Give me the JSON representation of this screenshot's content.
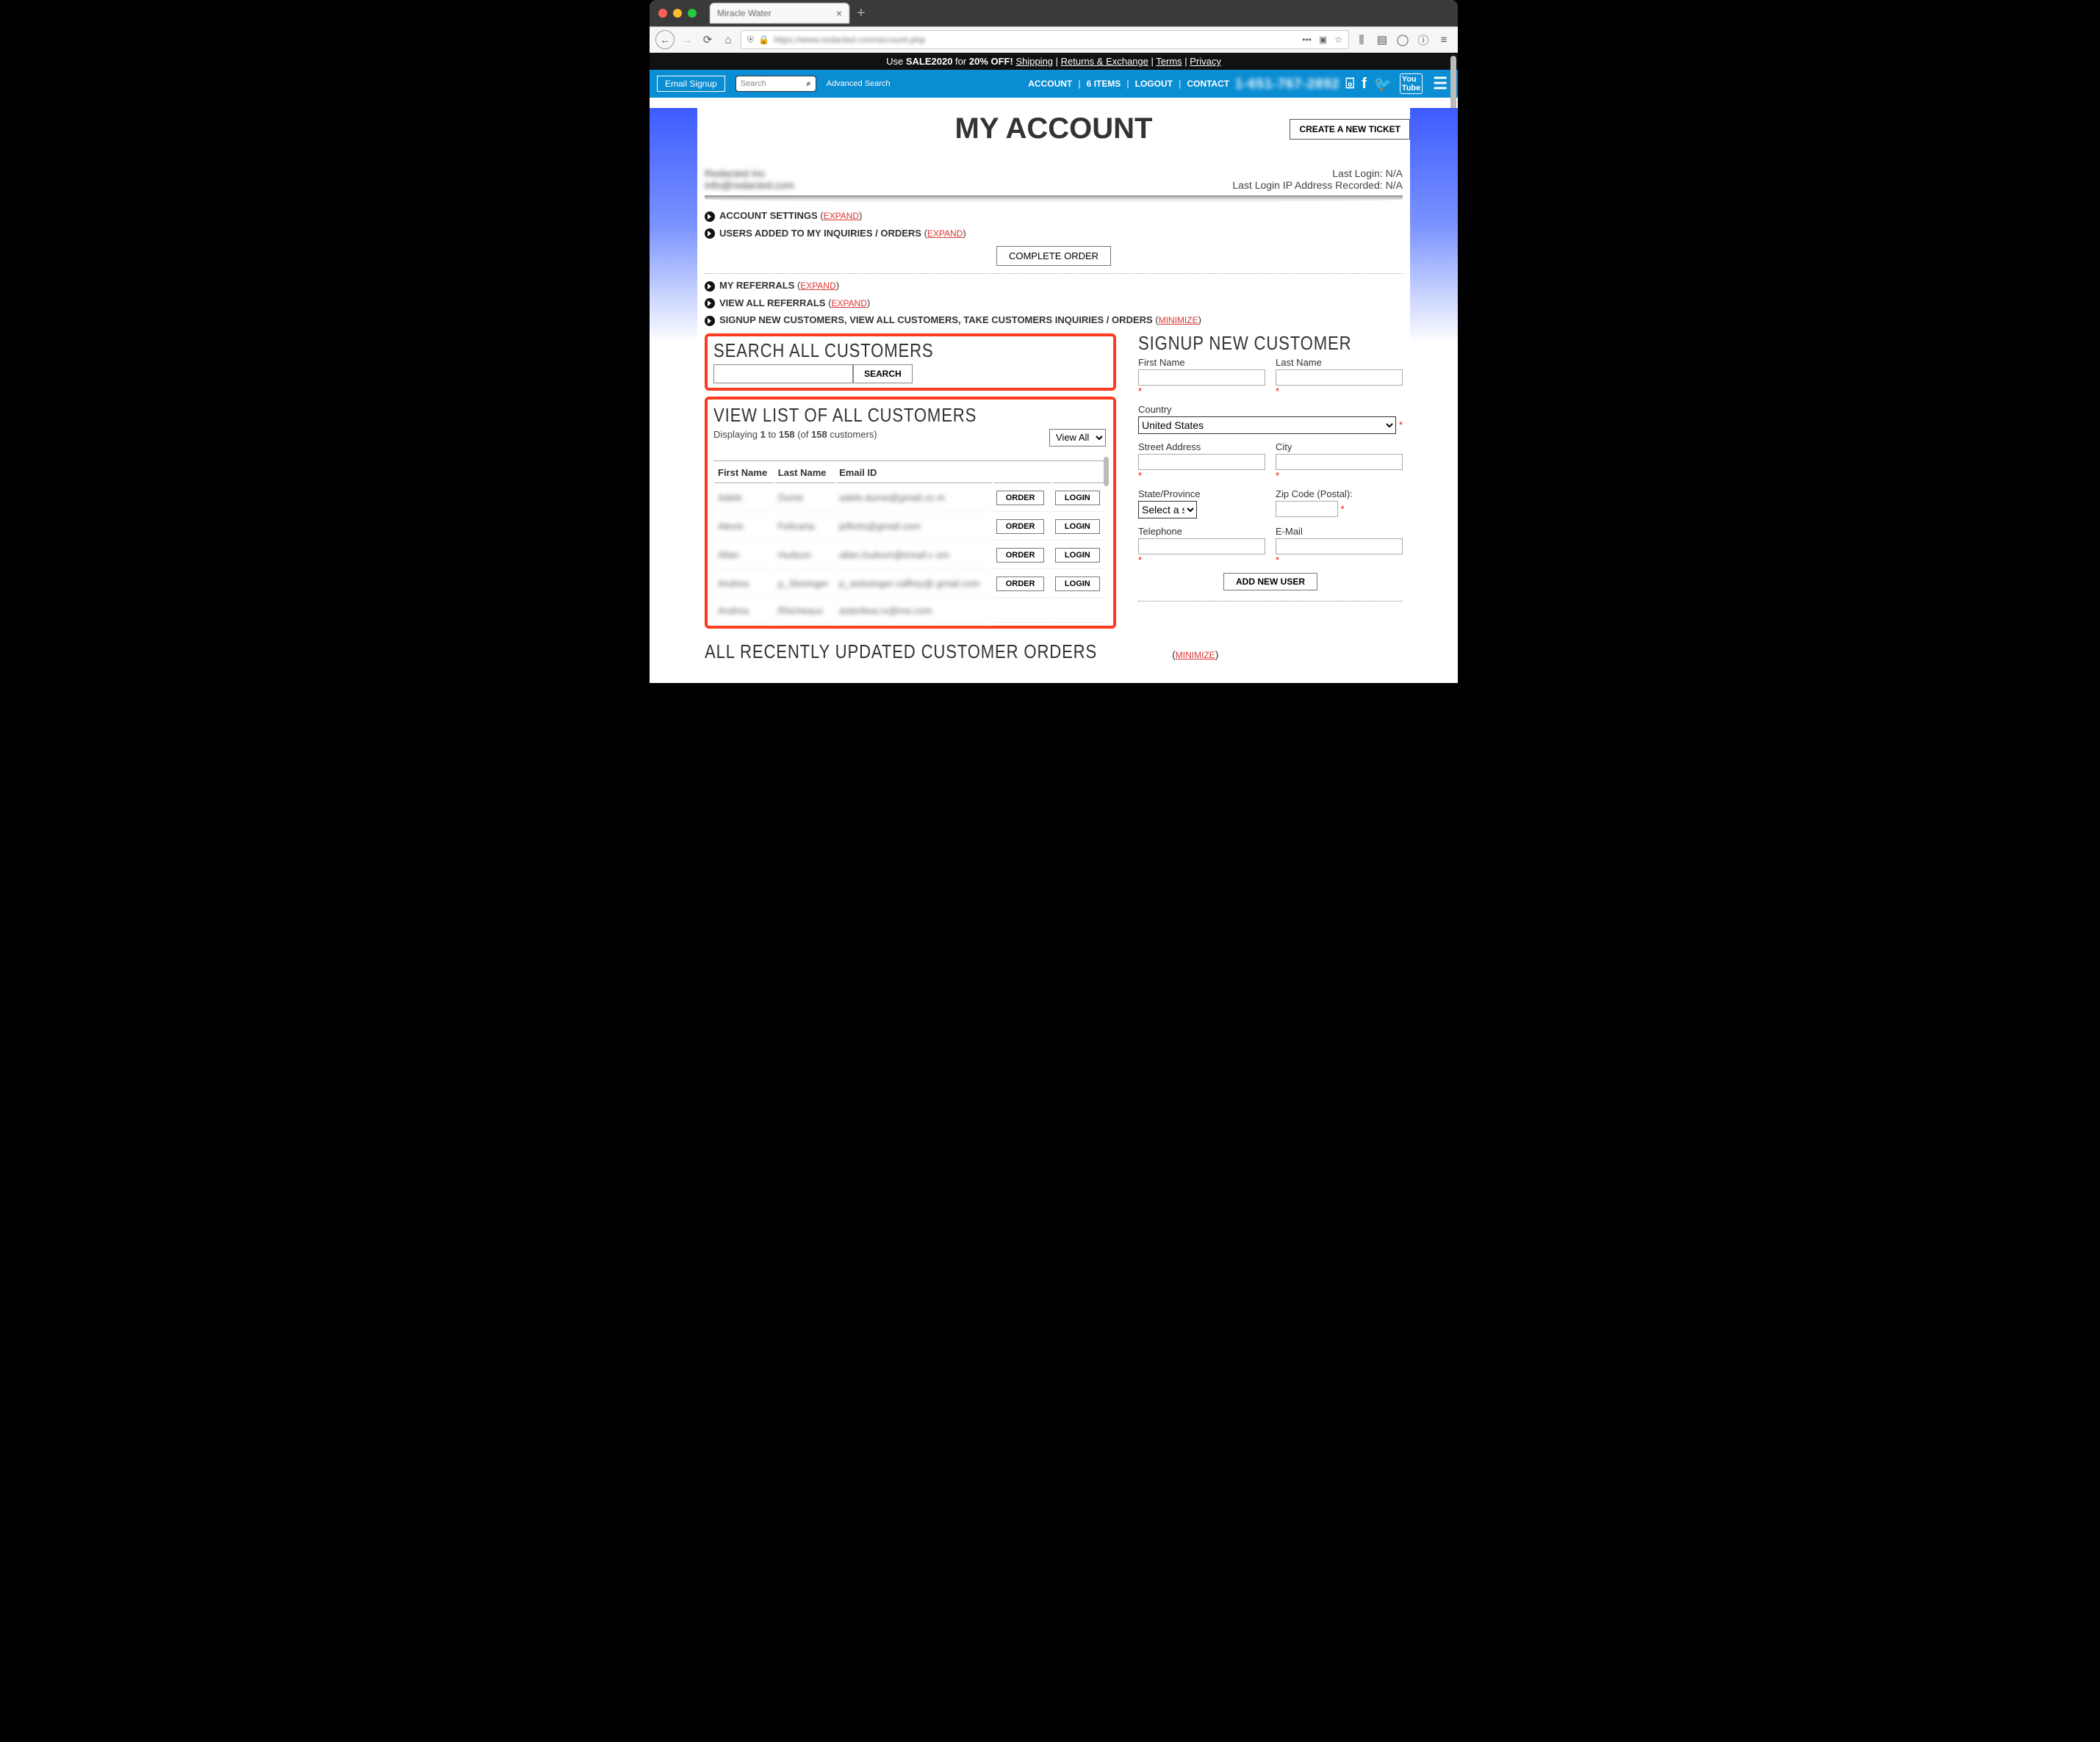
{
  "tab_title": "Miracle Water",
  "url_text": "https://www.redacted.com/account.php",
  "promo": {
    "use": "Use ",
    "code": "SALE2020",
    "for": " for ",
    "discount": "20% OFF!",
    "links": [
      "Shipping",
      "Returns & Exchange",
      "Terms",
      "Privacy"
    ]
  },
  "topbar": {
    "email_signup": "Email Signup",
    "search_placeholder": "Search",
    "advanced": "Advanced Search",
    "nav": [
      "ACCOUNT",
      "6 ITEMS",
      "LOGOUT",
      "CONTACT"
    ],
    "phone": "1-651-767-2892"
  },
  "page": {
    "title": "MY ACCOUNT",
    "ticket": "CREATE A NEW TICKET",
    "company": "Redacted Inc",
    "email": "info@redacted.com",
    "last_login": "Last Login: N/A",
    "last_ip": "Last Login IP Address Recorded: N/A",
    "complete_order": "COMPLETE ORDER"
  },
  "sections": {
    "acct": {
      "label": "ACCOUNT SETTINGS",
      "action": "EXPAND"
    },
    "users": {
      "label": "USERS ADDED TO MY INQUIRIES / ORDERS",
      "action": "EXPAND"
    },
    "refs": {
      "label": "MY REFERRALS",
      "action": "EXPAND"
    },
    "allrefs": {
      "label": "VIEW ALL REFERRALS",
      "action": "EXPAND"
    },
    "signup": {
      "label": "SIGNUP NEW CUSTOMERS, VIEW ALL CUSTOMERS, TAKE CUSTOMERS INQUIRIES / ORDERS",
      "action": "MINIMIZE"
    }
  },
  "searchall": {
    "title": "SEARCH ALL CUSTOMERS",
    "button": "SEARCH"
  },
  "listall": {
    "title": "VIEW LIST OF ALL CUSTOMERS",
    "display_pre": "Displaying ",
    "from": "1",
    "to_word": " to ",
    "to": "158",
    "of_word": " (of ",
    "total": "158",
    "suffix": " customers)",
    "viewall": "View All",
    "headers": [
      "First Name",
      "Last Name",
      "Email ID"
    ],
    "order": "ORDER",
    "login": "LOGIN",
    "rows": [
      {
        "fn": "Adele",
        "ln": "Dume",
        "em": "adele.dume@gmail.co m"
      },
      {
        "fn": "Alexis",
        "ln": "Felicarta",
        "em": "jeflorts@gmail.com"
      },
      {
        "fn": "Allan",
        "ln": "Hudson",
        "em": "allan.hudson@email.c om"
      },
      {
        "fn": "Andrea",
        "ln": "p_Slesinger",
        "em": "p_aslesinger.caffrey@ gmail.com"
      },
      {
        "fn": "Andrea",
        "ln": "Rhicheaux",
        "em": "asterikea.rx@me.com"
      }
    ]
  },
  "signupform": {
    "title": "SIGNUP NEW CUSTOMER",
    "fn": "First Name",
    "ln": "Last Name",
    "country": "Country",
    "country_val": "United States",
    "street": "Street Address",
    "city": "City",
    "state": "State/Province",
    "state_val": "Select a state",
    "zip": "Zip Code (Postal):",
    "phone": "Telephone",
    "email": "E-Mail",
    "add": "ADD NEW USER"
  },
  "bottom": {
    "title": "ALL RECENTLY UPDATED CUSTOMER ORDERS",
    "action": "MINIMIZE"
  }
}
